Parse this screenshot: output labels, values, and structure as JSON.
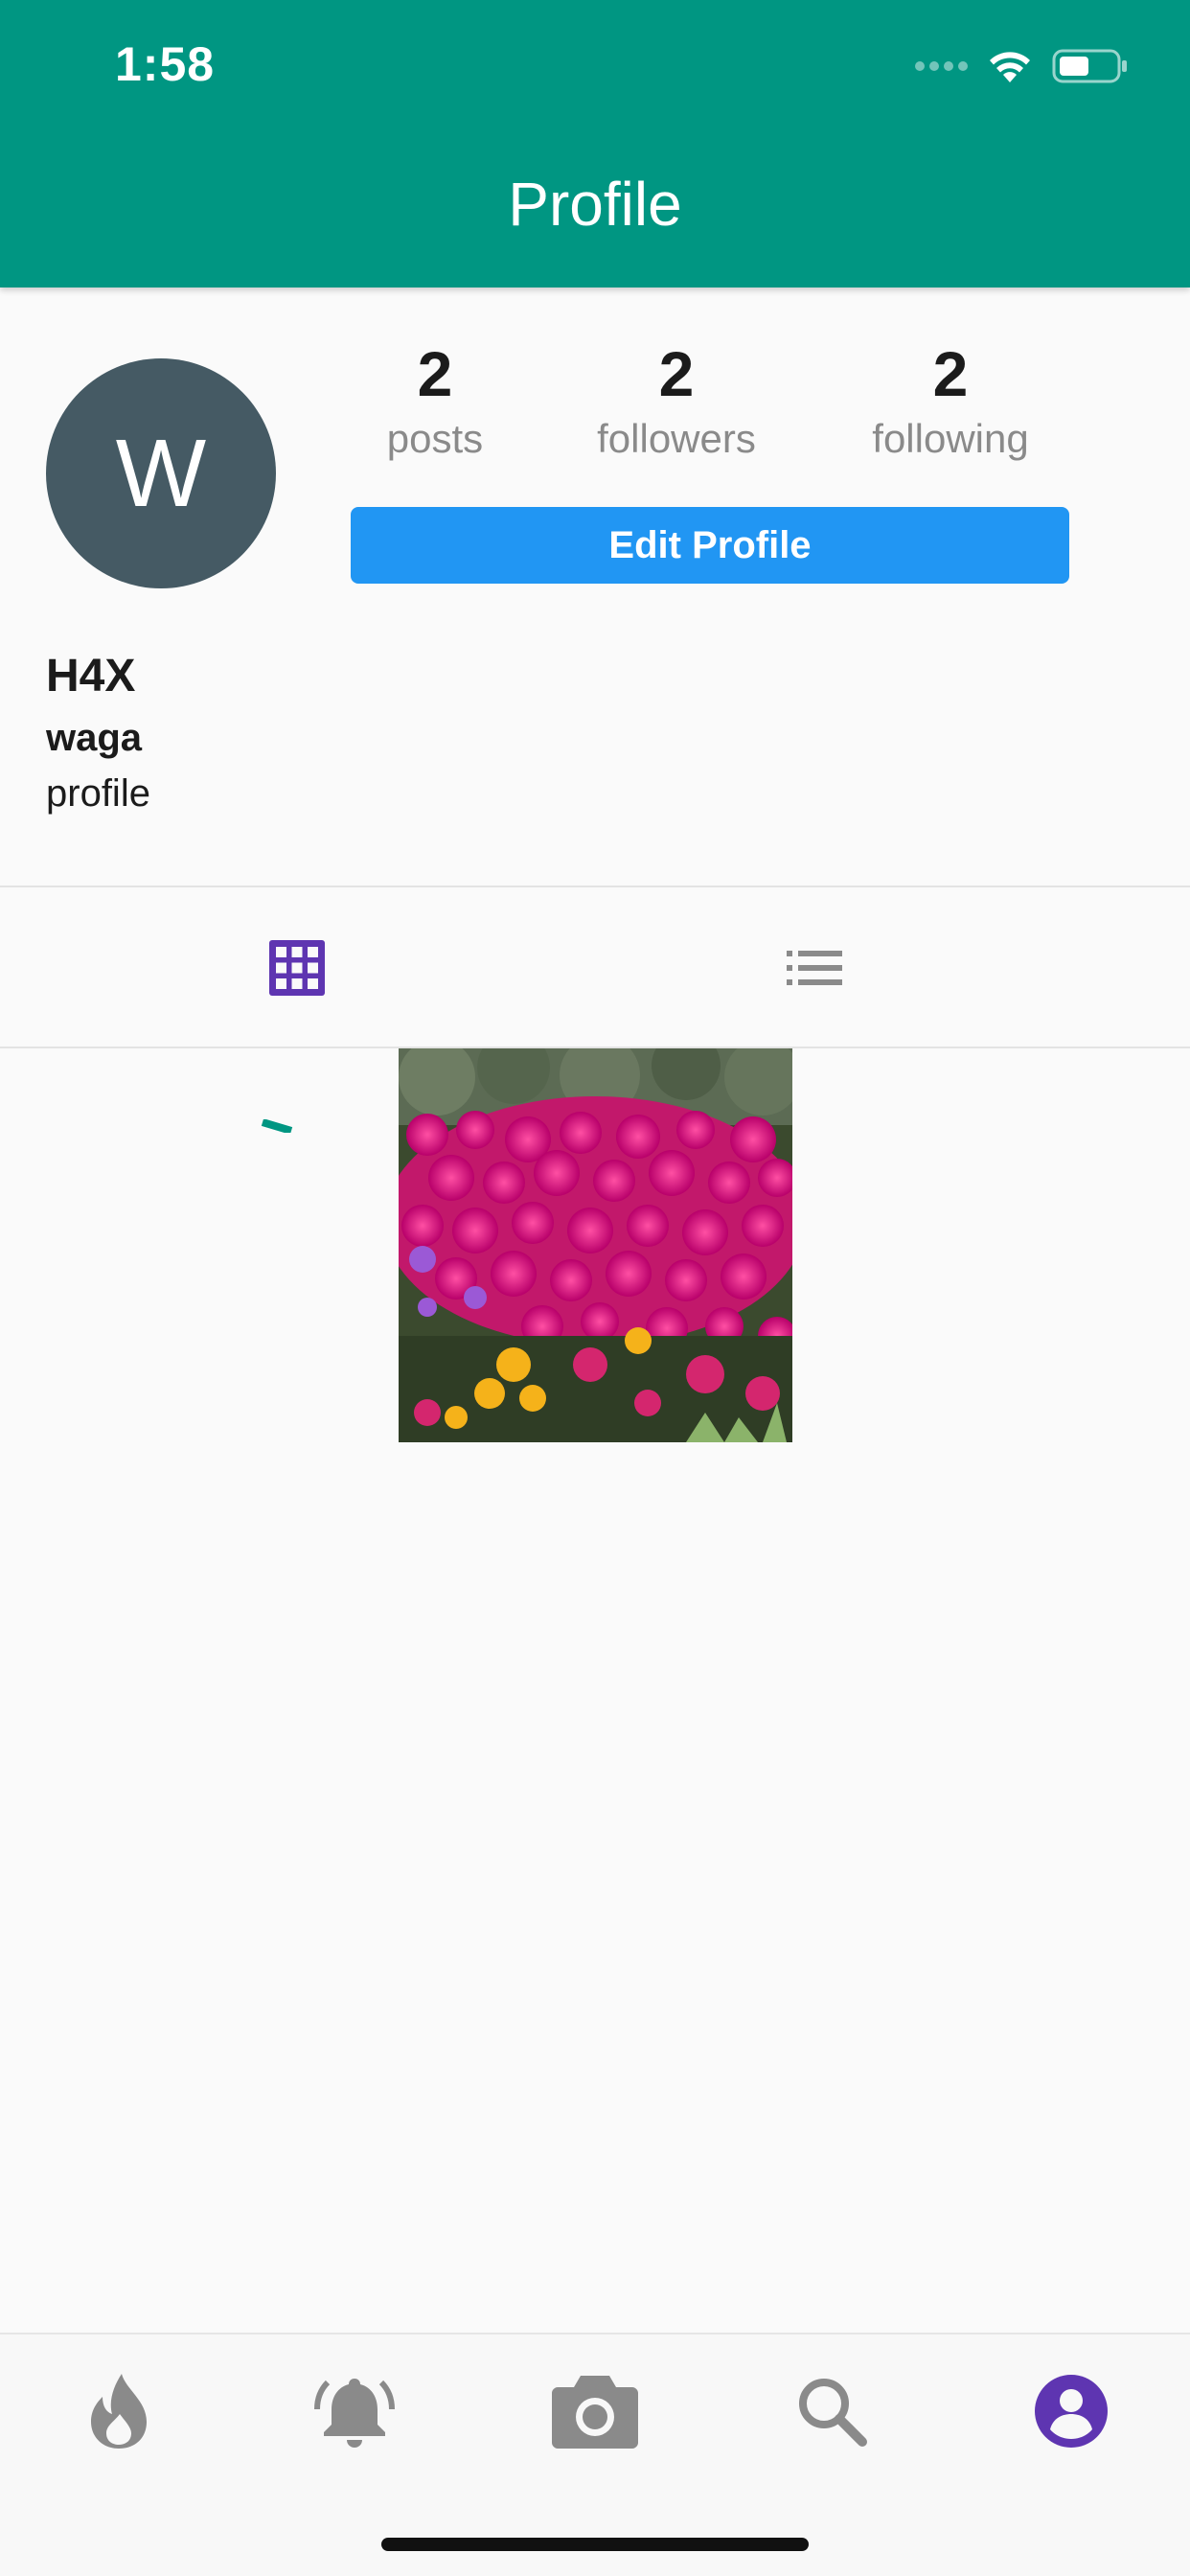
{
  "status_bar": {
    "time": "1:58",
    "icons": [
      "signal-dots-icon",
      "wifi-icon",
      "battery-icon"
    ]
  },
  "header": {
    "title": "Profile",
    "background_color": "#009682"
  },
  "profile": {
    "avatar_letter": "W",
    "avatar_color": "#455a64",
    "stats": [
      {
        "value": "2",
        "label": "posts"
      },
      {
        "value": "2",
        "label": "followers"
      },
      {
        "value": "2",
        "label": "following"
      }
    ],
    "edit_button_label": "Edit Profile",
    "edit_button_color": "#2196f3",
    "display_name": "H4X",
    "username": "waga",
    "bio": "profile"
  },
  "view_tabs": [
    {
      "name": "grid-view",
      "icon": "grid-icon",
      "active": true,
      "color": "#5e35b1"
    },
    {
      "name": "list-view",
      "icon": "list-icon",
      "active": false,
      "color": "#8a8a8a"
    }
  ],
  "posts": [
    {
      "content": "photo of magenta and yellow ice plant flowers"
    }
  ],
  "bottom_nav": [
    {
      "name": "feed",
      "icon": "flame-icon",
      "active": false
    },
    {
      "name": "notifications",
      "icon": "bell-icon",
      "active": false
    },
    {
      "name": "upload",
      "icon": "camera-icon",
      "active": false
    },
    {
      "name": "search",
      "icon": "search-icon",
      "active": false
    },
    {
      "name": "profile",
      "icon": "account-icon",
      "active": true
    }
  ],
  "colors": {
    "accent": "#5e35b1",
    "inactive_icon": "#8a8a8a"
  }
}
